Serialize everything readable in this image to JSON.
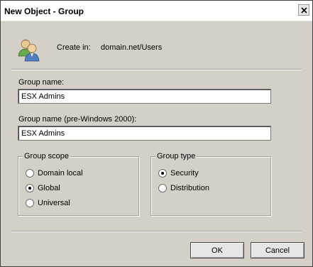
{
  "window": {
    "title": "New Object - Group"
  },
  "location": {
    "label": "Create in:",
    "value": "domain.net/Users"
  },
  "group_name": {
    "label": "Group name:",
    "value": "ESX Admins"
  },
  "group_name_pre2000": {
    "label": "Group name (pre-Windows 2000):",
    "value": "ESX Admins"
  },
  "group_scope": {
    "legend": "Group scope",
    "options": [
      {
        "label": "Domain local",
        "selected": false
      },
      {
        "label": "Global",
        "selected": true
      },
      {
        "label": "Universal",
        "selected": false
      }
    ]
  },
  "group_type": {
    "legend": "Group type",
    "options": [
      {
        "label": "Security",
        "selected": true
      },
      {
        "label": "Distribution",
        "selected": false
      }
    ]
  },
  "buttons": {
    "ok": "OK",
    "cancel": "Cancel"
  },
  "icons": {
    "close": "close-icon",
    "create_in": "group-users-icon"
  }
}
